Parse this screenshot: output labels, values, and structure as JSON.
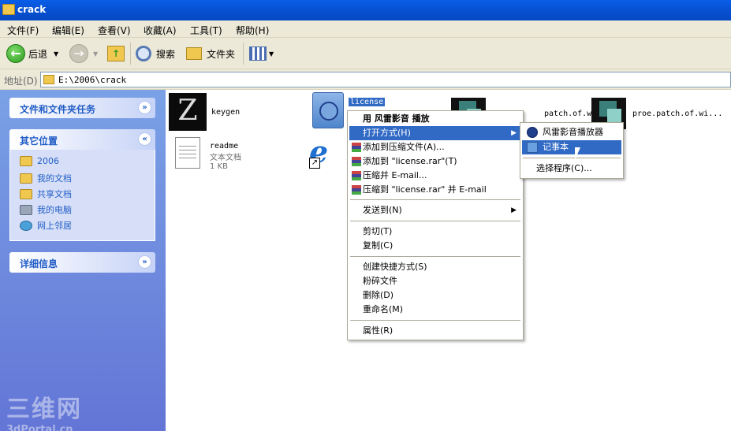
{
  "window": {
    "title": "crack"
  },
  "menu": [
    "文件(F)",
    "编辑(E)",
    "查看(V)",
    "收藏(A)",
    "工具(T)",
    "帮助(H)"
  ],
  "toolbar": {
    "back": "后退",
    "search": "搜索",
    "folders": "文件夹"
  },
  "address": {
    "label": "地址(D)",
    "value": "E:\\2006\\crack"
  },
  "taskpane": {
    "file_tasks": "文件和文件夹任务",
    "other_places": "其它位置",
    "places": [
      "2006",
      "我的文档",
      "共享文档",
      "我的电脑",
      "网上邻居"
    ],
    "details": "详细信息",
    "watermark_1": "三维网",
    "watermark_2": "3dPortal.cn"
  },
  "files": {
    "keygen": "keygen",
    "readme": "readme",
    "readme_type": "文本文档",
    "readme_size": "1 KB",
    "license": "license",
    "patch1": "patch.of.wi...",
    "patch2": "proe.patch.of.wi..."
  },
  "context_menu": {
    "items": [
      "用 风雷影音 播放",
      "打开方式(H)",
      "添加到压缩文件(A)...",
      "添加到 \"license.rar\"(T)",
      "压缩并 E-mail...",
      "压缩到 \"license.rar\" 并 E-mail",
      "发送到(N)",
      "剪切(T)",
      "复制(C)",
      "创建快捷方式(S)",
      "粉碎文件",
      "删除(D)",
      "重命名(M)",
      "属性(R)"
    ]
  },
  "submenu": {
    "items": [
      "风雷影音播放器",
      "记事本",
      "选择程序(C)..."
    ]
  },
  "colors": {
    "titlebar": "#0853d6",
    "selection": "#316ac5",
    "taskpane": "#6f8ce0"
  }
}
